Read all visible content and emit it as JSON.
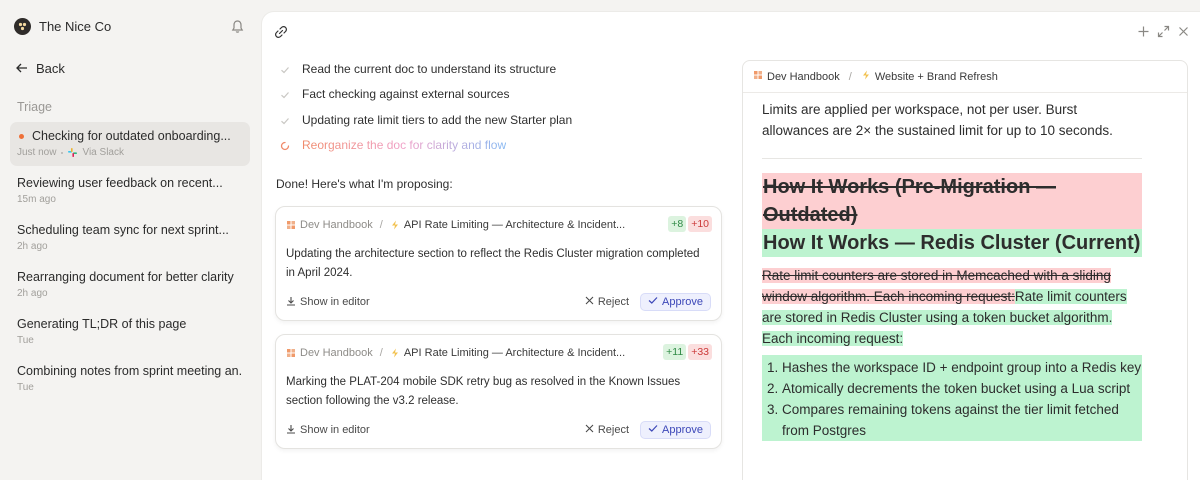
{
  "sidebar": {
    "brand": "The Nice Co",
    "back_label": "Back",
    "section_label": "Triage",
    "threads": [
      {
        "title": "Checking for outdated onboarding...",
        "time": "Just now",
        "source": "Via Slack",
        "active": true
      },
      {
        "title": "Reviewing user feedback on recent...",
        "time": "15m ago"
      },
      {
        "title": "Scheduling team sync for next sprint...",
        "time": "2h ago"
      },
      {
        "title": "Rearranging document for better clarity",
        "time": "2h ago"
      },
      {
        "title": "Generating TL;DR of this page",
        "time": "Tue"
      },
      {
        "title": "Combining notes from sprint meeting an...",
        "time": "Tue"
      }
    ]
  },
  "steps": [
    {
      "label": "Read the current doc to understand its structure",
      "state": "done"
    },
    {
      "label": "Fact checking against external sources",
      "state": "done"
    },
    {
      "label": "Updating rate limit tiers to add the new Starter plan",
      "state": "done"
    },
    {
      "label": "Reorganize the doc for clarity and flow",
      "state": "running"
    }
  ],
  "done_message": "Done! Here's what I'm proposing:",
  "proposals": [
    {
      "space": "Dev Handbook",
      "doc": "API Rate Limiting — Architecture & Incident...",
      "additions": "+8",
      "deletions": "+10",
      "body": "Updating the architecture section to reflect the Redis Cluster migration completed in April 2024.",
      "show_label": "Show in editor",
      "reject_label": "Reject",
      "approve_label": "Approve"
    },
    {
      "space": "Dev Handbook",
      "doc": "API Rate Limiting — Architecture & Incident...",
      "additions": "+11",
      "deletions": "+33",
      "body": "Marking the PLAT-204 mobile SDK retry bug as resolved in the Known Issues section following the v3.2 release.",
      "show_label": "Show in editor",
      "reject_label": "Reject",
      "approve_label": "Approve"
    }
  ],
  "preview": {
    "space": "Dev Handbook",
    "doc": "Website + Brand Refresh",
    "intro": "Limits are applied per workspace, not per user. Burst allowances are 2× the sustained limit for up to 10 seconds.",
    "heading_removed": "How It Works (Pre-Migration — Outdated)",
    "heading_added": "How It Works — Redis Cluster (Current)",
    "body_removed": "Rate limit counters are stored in Memcached with a sliding window algorithm. Each incoming request:",
    "body_added": "Rate limit counters are stored in Redis Cluster using a token bucket algorithm. Each incoming request:",
    "list": [
      "Hashes the workspace ID + endpoint group into a Redis key",
      "Atomically decrements the token bucket using a Lua script",
      "Compares remaining tokens against the tier limit fetched from Postgres"
    ]
  },
  "colors": {
    "accent_orange": "#ee7038",
    "approve_blue": "#3c47b8",
    "diff_added": "#bdf3d0",
    "diff_removed": "#fdcfd1"
  }
}
